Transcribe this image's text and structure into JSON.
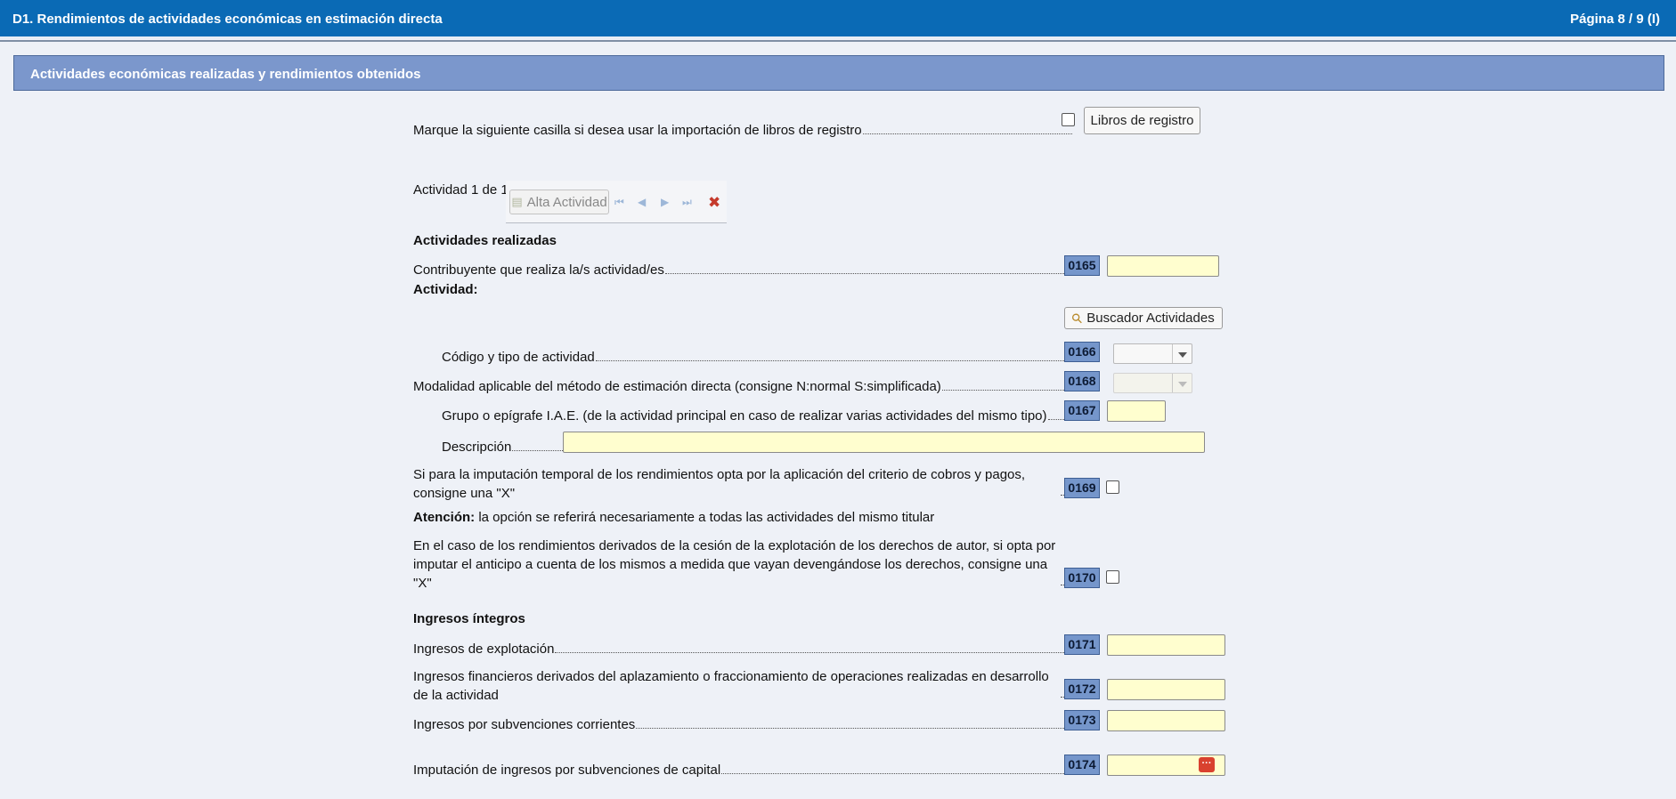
{
  "header": {
    "title": "D1.  Rendimientos de actividades económicas en estimación directa",
    "page": "Página 8 / 9 (I)"
  },
  "section": {
    "title": "Actividades económicas realizadas y rendimientos obtenidos"
  },
  "libros": {
    "label": "Marque la siguiente casilla si desea usar la importación de libros de registro",
    "button": "Libros de registro"
  },
  "activity_nav": {
    "counter": "Actividad 1 de 1",
    "add_button": "Alta Actividad"
  },
  "realizadas": {
    "heading": "Actividades realizadas",
    "contribuyente_label": "Contribuyente que realiza la/s actividad/es",
    "contribuyente_code": "0165",
    "actividad_heading": "Actividad:",
    "buscador_button": "Buscador Actividades",
    "codigo_label": "Código y tipo de actividad",
    "codigo_code": "0166",
    "modalidad_label": "Modalidad aplicable del método de estimación directa (consigne N:normal S:simplificada)",
    "modalidad_code": "0168",
    "grupo_label": "Grupo o epígrafe I.A.E. (de la actividad principal en caso de realizar varias actividades del mismo tipo)",
    "grupo_code": "0167",
    "descripcion_label": "Descripción",
    "cobros_line1": "Si para la imputación temporal de los rendimientos opta por la aplicación del criterio de cobros y pagos,",
    "cobros_line2": "consigne una \"X\"",
    "cobros_code": "0169",
    "atencion_bold": "Atención:",
    "atencion_text": " la opción se referirá necesariamente a todas las actividades del mismo titular",
    "autor_line1": "En el caso de los rendimientos derivados de la cesión de la explotación de los derechos de autor, si opta por",
    "autor_line2": "imputar el anticipo a cuenta de los mismos a medida que vayan devengándose los derechos, consigne una",
    "autor_line3": "\"X\"",
    "autor_code": "0170"
  },
  "ingresos": {
    "heading": "Ingresos íntegros",
    "explotacion_label": "Ingresos de explotación",
    "explotacion_code": "0171",
    "financieros_line1": "Ingresos financieros derivados del aplazamiento o fraccionamiento de operaciones realizadas en desarrollo",
    "financieros_line2": "de la actividad",
    "financieros_code": "0172",
    "subv_corr_label": "Ingresos por subvenciones corrientes",
    "subv_corr_code": "0173",
    "subv_cap_label": "Imputación de ingresos por subvenciones de capital",
    "subv_cap_code": "0174"
  },
  "icons": {
    "first": "⏮",
    "prev": "◀",
    "next": "▶",
    "last": "⏭",
    "delete": "✖",
    "search": "⚲",
    "ellipsis": "···"
  }
}
